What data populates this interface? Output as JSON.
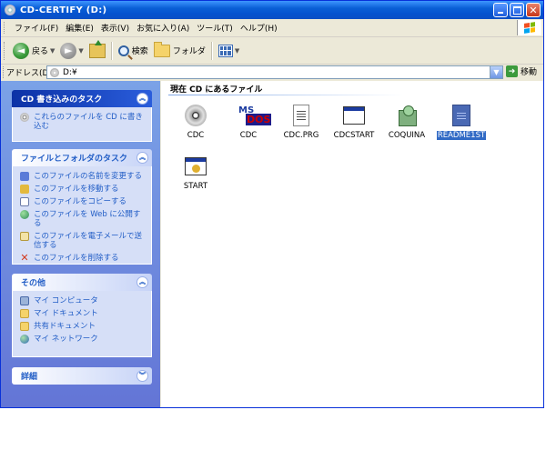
{
  "window": {
    "title": "CD-CERTIFY (D:)"
  },
  "menu": [
    "ファイル(F)",
    "編集(E)",
    "表示(V)",
    "お気に入り(A)",
    "ツール(T)",
    "ヘルプ(H)"
  ],
  "toolbar": {
    "back_label": "戻る",
    "search_label": "検索",
    "folders_label": "フォルダ"
  },
  "address": {
    "label": "アドレス(D)",
    "value": "D:¥",
    "go_label": "移動"
  },
  "tasks_panels": [
    {
      "title": "CD 書き込みのタスク",
      "items": [
        "これらのファイルを CD に書き込む"
      ]
    },
    {
      "title": "ファイルとフォルダのタスク",
      "items": [
        "このファイルの名前を変更する",
        "このファイルを移動する",
        "このファイルをコピーする",
        "このファイルを Web に公開する",
        "このファイルを電子メールで送信する",
        "このファイルを削除する"
      ]
    },
    {
      "title": "その他",
      "items": [
        "マイ コンピュータ",
        "マイ ドキュメント",
        "共有ドキュメント",
        "マイ ネットワーク"
      ]
    },
    {
      "title": "詳細",
      "items": []
    }
  ],
  "content": {
    "section_title": "現在 CD にあるファイル",
    "files": [
      {
        "name": "CDC",
        "icon": "cd-icon",
        "selected": false
      },
      {
        "name": "CDC",
        "icon": "msdos-icon",
        "selected": false
      },
      {
        "name": "CDC.PRG",
        "icon": "document-icon",
        "selected": false
      },
      {
        "name": "CDCSTART",
        "icon": "application-icon",
        "selected": false
      },
      {
        "name": "COQUINA",
        "icon": "setup-icon",
        "selected": false
      },
      {
        "name": "README1ST",
        "icon": "text-file-icon",
        "selected": true
      },
      {
        "name": "START",
        "icon": "application-icon",
        "selected": false
      }
    ]
  }
}
